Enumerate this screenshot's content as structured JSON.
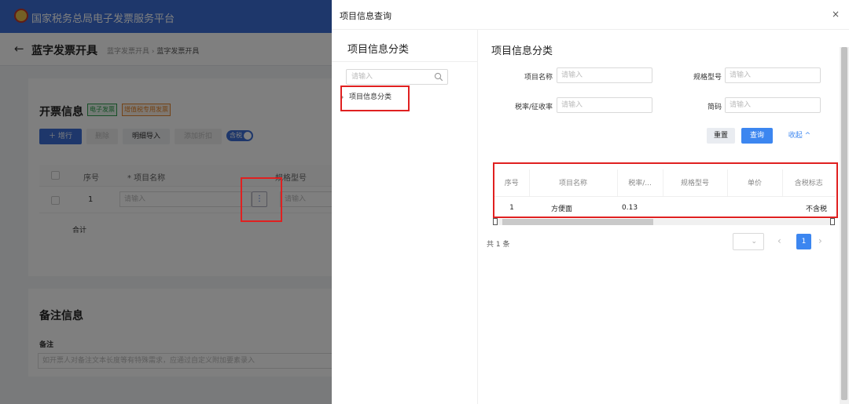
{
  "app": {
    "title": "国家税务总局电子发票服务平台"
  },
  "page": {
    "title": "蓝字发票开具",
    "breadcrumb": [
      "蓝字发票开具",
      "蓝字发票开具"
    ]
  },
  "invoice_section": {
    "title": "开票信息",
    "tags": [
      "电子发票",
      "增值税专用发票"
    ],
    "toolbar": [
      "增行",
      "删除",
      "明细导入",
      "添加折扣"
    ],
    "tax_toggle_label": "含税",
    "table_headers": [
      "序号",
      "* 项目名称",
      "规格型号"
    ],
    "row": {
      "index": "1",
      "placeholder": "请输入"
    },
    "total_label": "合计"
  },
  "remark_section": {
    "title": "备注信息",
    "label": "备注",
    "placeholder": "如开票人对备注文本长度等有特殊需求，应通过自定义附加要素录入"
  },
  "dialog": {
    "title": "项目信息查询",
    "close": "×",
    "left": {
      "title": "项目信息分类",
      "search_placeholder": "请输入",
      "tree_node": "项目信息分类"
    },
    "right": {
      "title": "项目信息分类",
      "fields": {
        "item_name_label": "项目名称",
        "spec_label": "规格型号",
        "tax_rate_label": "税率/征收率",
        "short_code_label": "简码",
        "placeholder": "请输入"
      },
      "buttons": {
        "reset": "重置",
        "query": "查询",
        "collapse": "收起 ^"
      },
      "table": {
        "headers": [
          "序号",
          "项目名称",
          "税率/...",
          "规格型号",
          "单价",
          "含税标志"
        ],
        "rows": [
          {
            "index": "1",
            "name": "方便面",
            "tax_rate": "0.13",
            "spec": "",
            "price": "",
            "tax_flag": "不含税"
          }
        ]
      },
      "pagination": {
        "total": "共 1 条",
        "current_page": "1",
        "prev": "‹",
        "next": "›",
        "size_chevron": "⌄"
      }
    }
  },
  "colors": {
    "primary": "#3c6fd6",
    "highlight": "#e02020",
    "tag_green": "#2e9e4f",
    "tag_orange": "#e6862e"
  }
}
